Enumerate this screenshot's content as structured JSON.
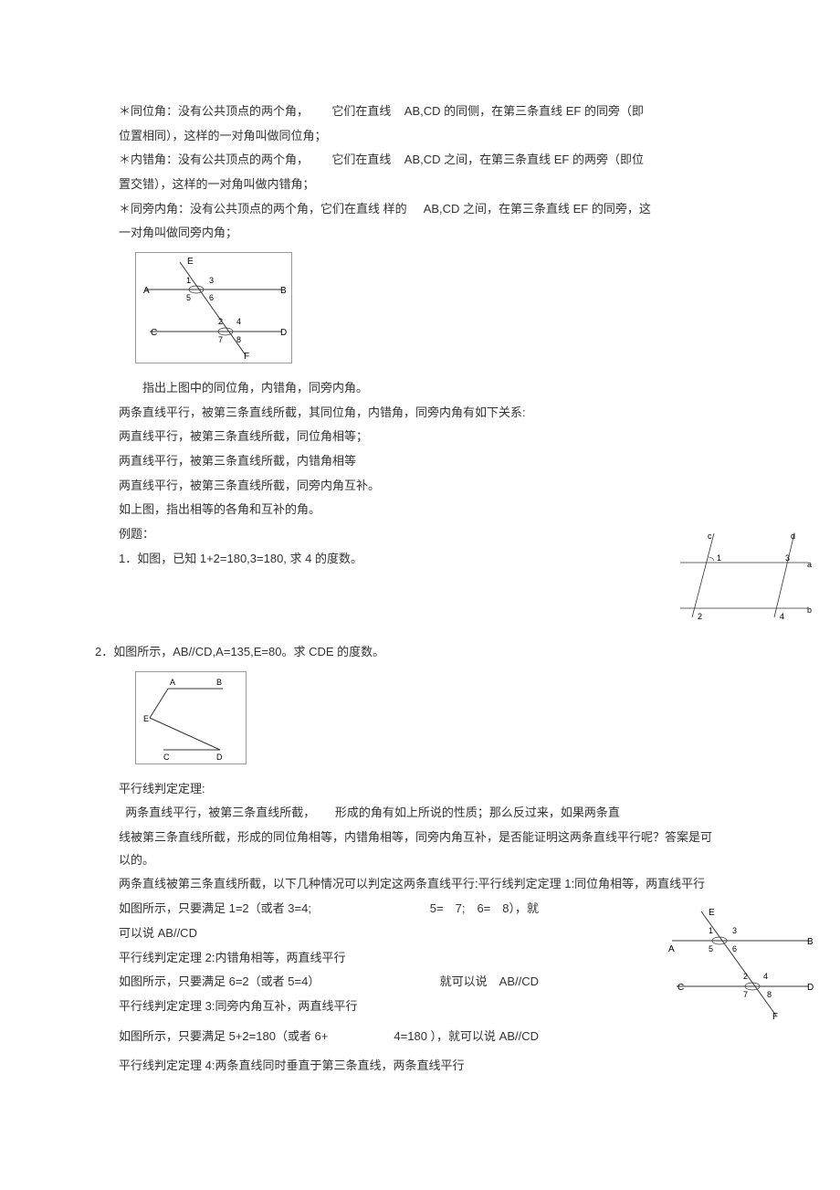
{
  "def1_a": "＊同位角：没有公共顶点的两个角，",
  "def1_b": "它们在直线",
  "def1_c": "AB,CD 的同侧，在第三条直线 EF 的同旁（即",
  "def1_d": "位置相同），这样的一对角叫做同位角；",
  "def2_a": "＊内错角：没有公共顶点的两个角，",
  "def2_b": "它们在直线",
  "def2_c": "AB,CD 之间，在第三条直线 EF 的两旁（即位",
  "def2_d": "置交错），这样的一对角叫做内错角；",
  "def3_a": "＊同旁内角：没有公共顶点的两个角，它们在直线 样的",
  "def3_b": "AB,CD 之间，在第三条直线 EF 的同旁，这",
  "def3_c": "一对角叫做同旁内角；",
  "fig1_caption": "指出上图中的同位角，内错角，同旁内角。",
  "p1": "两条直线平行，被第三条直线所截，其同位角，内错角，同旁内角有如下关系:",
  "p2": "两直线平行，被第三条直线所截，同位角相等；",
  "p3": "两直线平行，被第三条直线所截，内错角相等",
  "p4": "两直线平行，被第三条直线所截，同旁内角互补。",
  "p5": "如上图，指出相等的各角和互补的角。",
  "ex_title": "例题：",
  "ex1": "1．如图，已知 1+2=180,3=180, 求 4 的度数。",
  "ex2": "2．如图所示，AB//CD,A=135,E=80。求 CDE 的度数。",
  "th_title": "平行线判定定理:",
  "th_p1_a": "两条直线平行，被第三条直线所截，",
  "th_p1_b": "形成的角有如上所说的性质；那么反过来，如果两条直",
  "th_p2": "线被第三条直线所截，形成的同位角相等，内错角相等，同旁内角互补，是否能证明这两条直线平行呢？答案是可以的。",
  "th_p3": "两条直线被第三条直线所截，以下几种情况可以判定这两条直线平行:平行线判定定理 1:同位角相等，两直线平行",
  "th_p4_a": "如图所示，只要满足 1=2（或者 3=4;",
  "th_p4_b": "5=　7;　6=　8），就",
  "th_p4_c": "可以说 AB//CD",
  "th_p5": "平行线判定定理 2:内错角相等，两直线平行",
  "th_p6_a": "如图所示，只要满足 6=2（或者 5=4）",
  "th_p6_b": "就可以说　AB//CD",
  "th_p7": "平行线判定定理 3:同旁内角互补，两直线平行",
  "th_p8_a": "如图所示，只要满足 5+2=180（或者 6+",
  "th_p8_b": "4=180 ），就可以说 AB//CD",
  "th_p9": "平行线判定定理 4:两条直线同时垂直于第三条直线，两条直线平行"
}
